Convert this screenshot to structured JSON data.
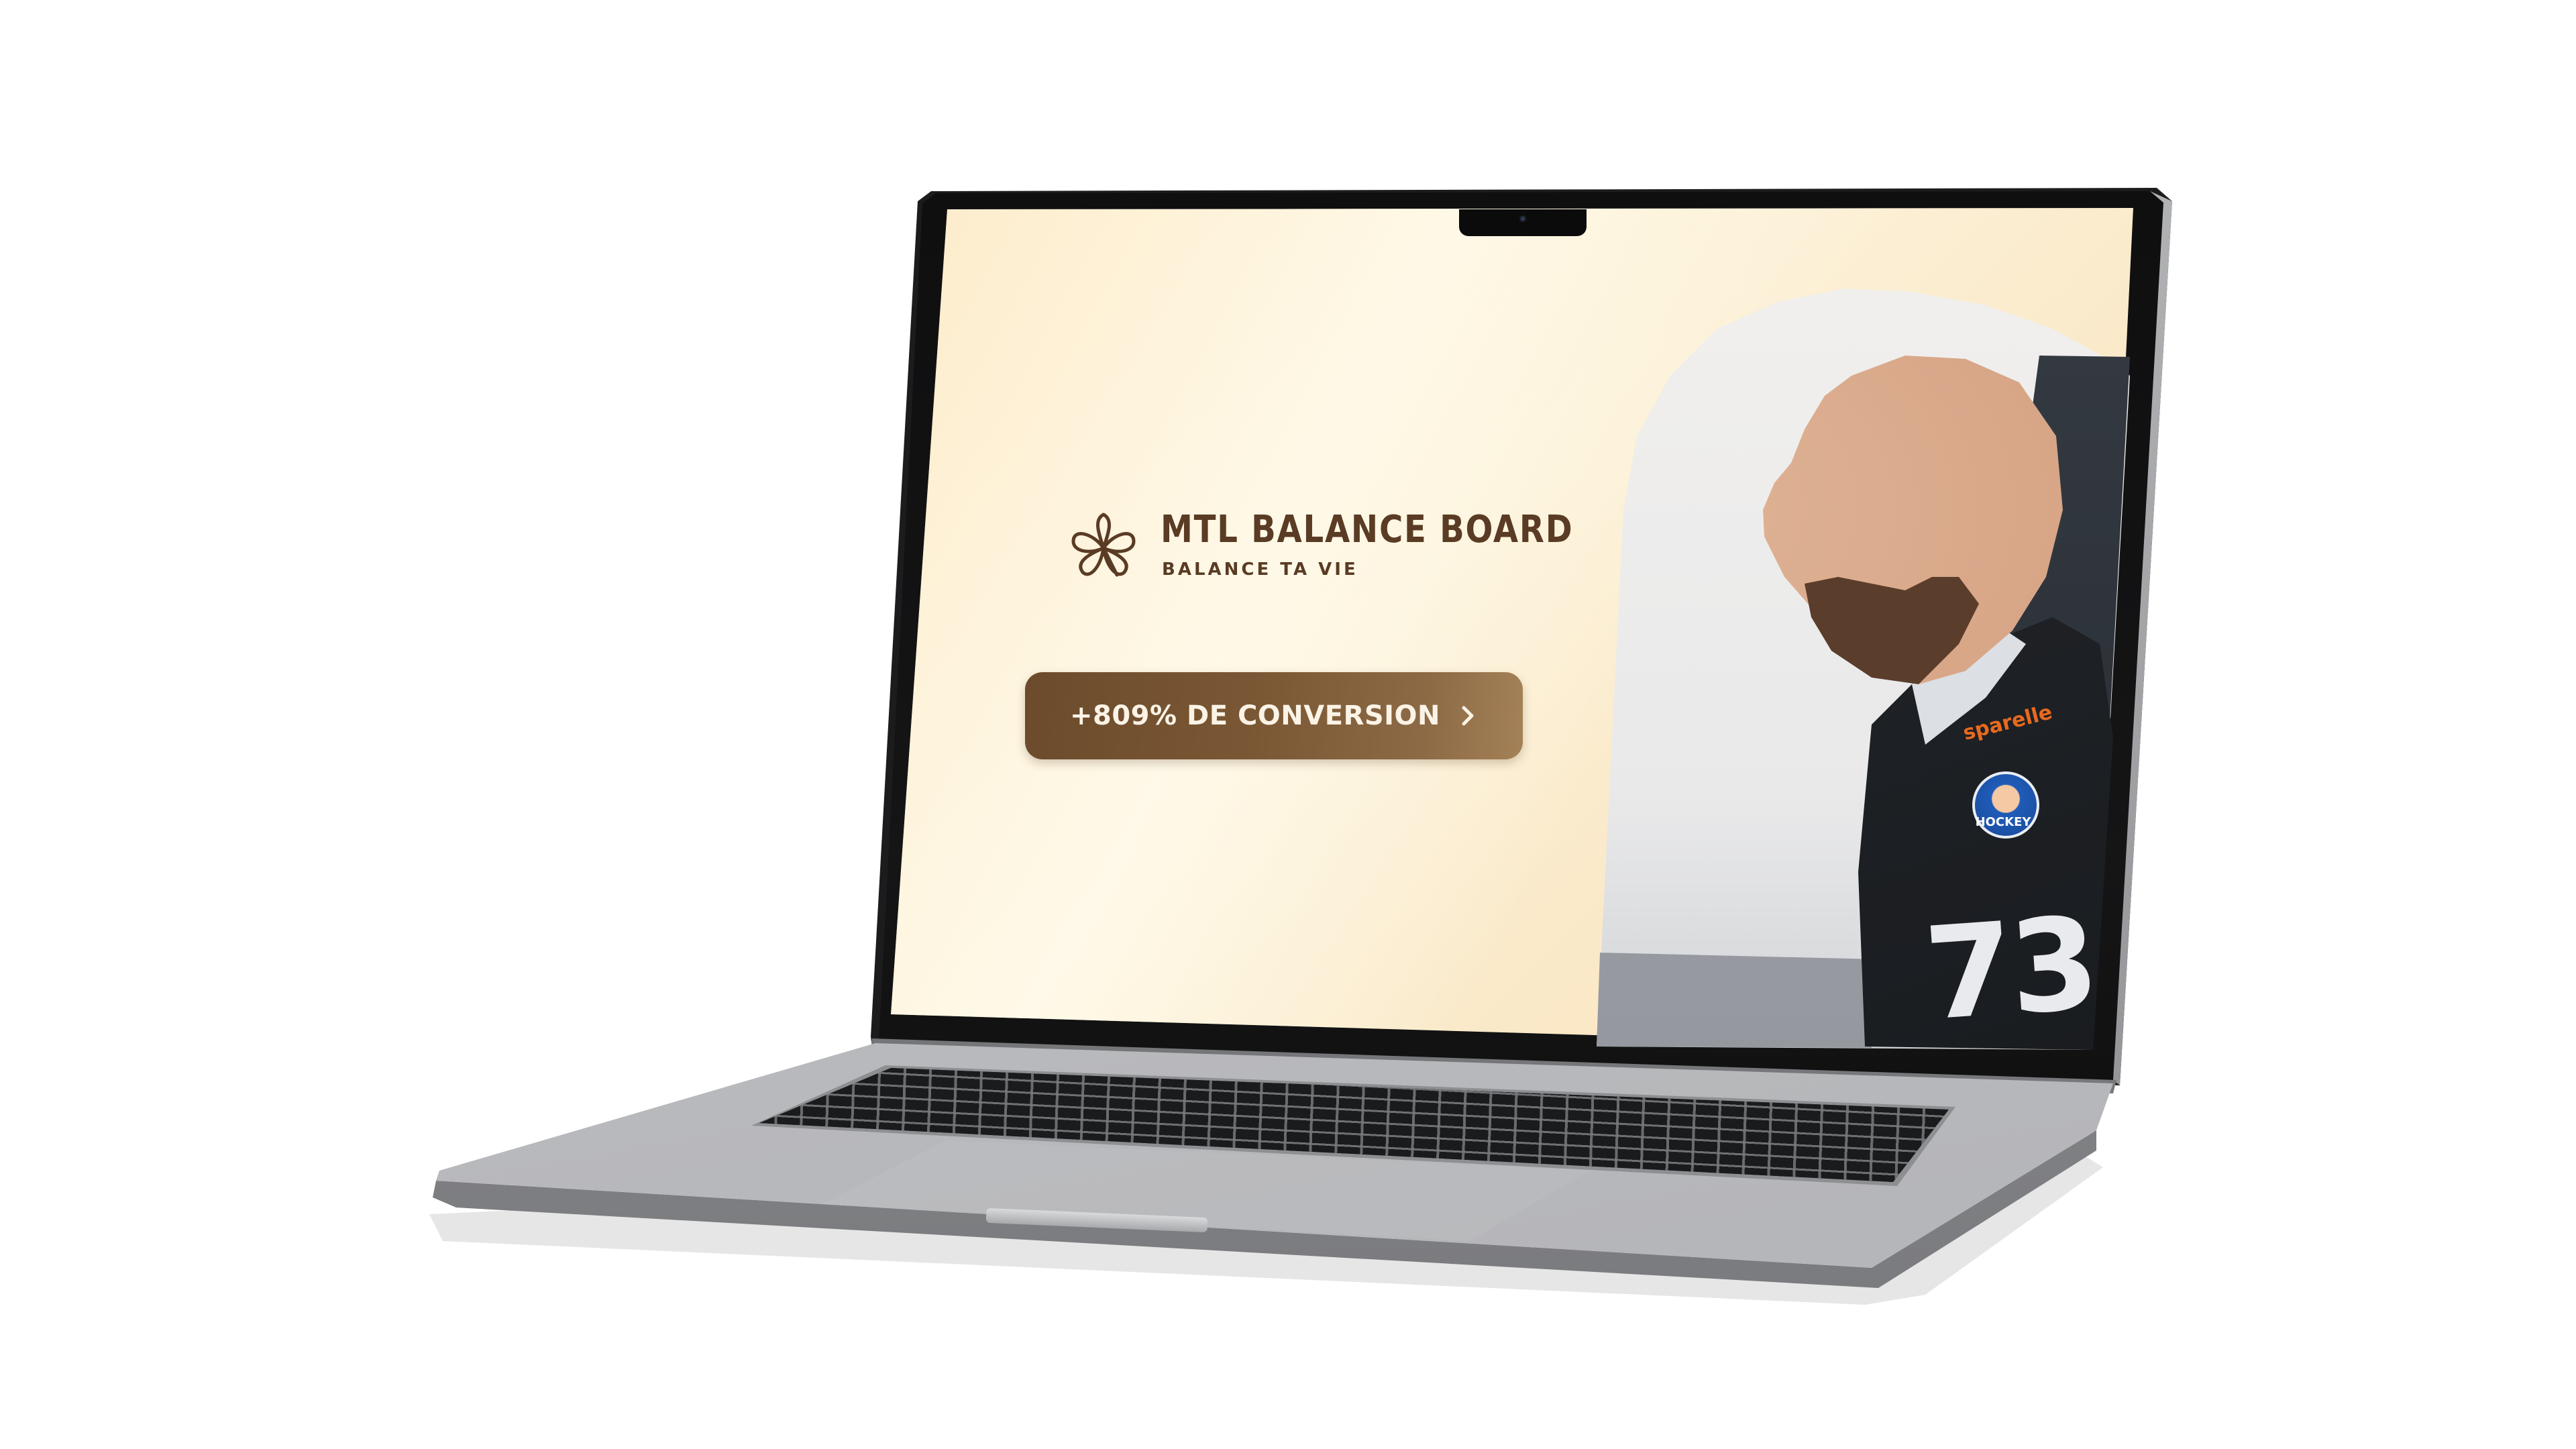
{
  "brand": {
    "name": "MTL BALANCE BOARD",
    "tagline": "BALANCE TA VIE"
  },
  "cta": {
    "label": "+809% DE CONVERSION"
  },
  "photo": {
    "jersey_brand": "sparelle",
    "jersey_logo_text": "HOCKEY",
    "jersey_number": "73"
  },
  "colors": {
    "background": "#fbe9c9",
    "brand_text": "#5a3b24",
    "cta_start": "#6b4b2c",
    "cta_end": "#a48157",
    "cta_text": "#fbf3e6"
  },
  "icons": {
    "logo": "clover-heart-logo-icon",
    "cta_chevron": "chevron-right-icon"
  }
}
